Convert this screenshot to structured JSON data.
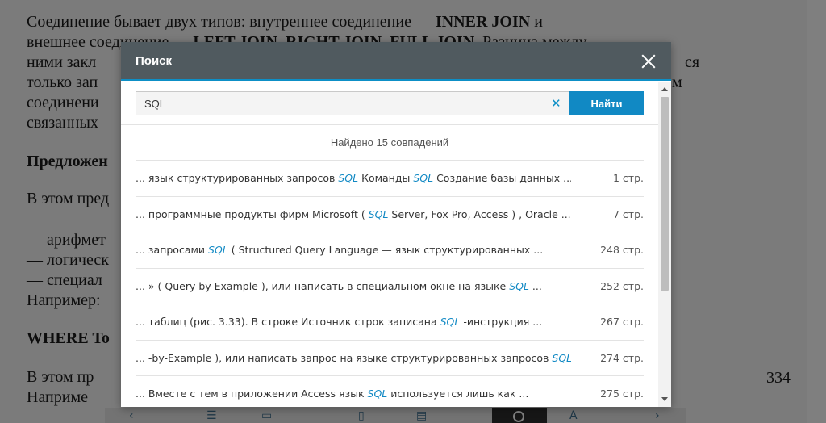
{
  "book": {
    "lines": [
      {
        "pre": "Соединение бывает двух типов: внутреннее соединение — ",
        "bold": "INNER JOIN",
        "post": " и"
      },
      {
        "pre": "внешнее соединение — ",
        "bold": "LEFT JOIN, RIGHT JOIN, FULL JOIN",
        "post": ". Разница между"
      },
      {
        "pre": "ними закл",
        "bold": "",
        "post": "ся"
      },
      {
        "pre": "только зап",
        "bold": "",
        "post": "м"
      },
      {
        "pre": "соединени",
        "bold": "",
        "post": ""
      },
      {
        "pre": "связанных",
        "bold": "",
        "post": ""
      },
      {
        "pre": "",
        "bold": "Предложен",
        "post": ""
      },
      {
        "pre": "В этом пред",
        "bold": "",
        "post": ""
      },
      {
        "pre": "— арифмет",
        "bold": "",
        "post": ""
      },
      {
        "pre": "— логическ",
        "bold": "",
        "post": ""
      },
      {
        "pre": "— специал",
        "bold": "",
        "post": ""
      },
      {
        "pre": "Например:",
        "bold": "",
        "post": ""
      },
      {
        "pre": "",
        "bold": "WHERE To",
        "post": ""
      },
      {
        "pre": "В этом пр",
        "bold": "",
        "post": ""
      },
      {
        "pre": "Наприме",
        "bold": "",
        "post": ""
      }
    ],
    "page_number": "334"
  },
  "dialog": {
    "title": "Поиск",
    "search": {
      "value": "SQL",
      "placeholder": "",
      "clear_glyph": "✕",
      "button_label": "Найти"
    },
    "found_text": "Найдено 15 совпадений",
    "results": [
      {
        "parts": [
          {
            "t": "... язык структурированных запросов ",
            "h": false
          },
          {
            "t": "SQL",
            "h": true
          },
          {
            "t": " Команды ",
            "h": false
          },
          {
            "t": "SQL",
            "h": true
          },
          {
            "t": " Создание базы данных ...",
            "h": false
          }
        ],
        "page": "1 стр."
      },
      {
        "parts": [
          {
            "t": "... программные продукты фирм Microsoft ( ",
            "h": false
          },
          {
            "t": "SQL",
            "h": true
          },
          {
            "t": " Server, Fox Pro, Access ) , Oracle ...",
            "h": false
          }
        ],
        "page": "7 стр."
      },
      {
        "parts": [
          {
            "t": "... запросами ",
            "h": false
          },
          {
            "t": "SQL",
            "h": true
          },
          {
            "t": " ( Structured Query Language  — язык структурированных ...",
            "h": false
          }
        ],
        "page": "248 стр."
      },
      {
        "parts": [
          {
            "t": "... » ( Query by Example ), или написать в специальном окне на языке ",
            "h": false
          },
          {
            "t": "SQL",
            "h": true
          },
          {
            "t": " ...",
            "h": false
          }
        ],
        "page": "252 стр."
      },
      {
        "parts": [
          {
            "t": "... таблиц (рис. 3.33). В строке Источник строк записана ",
            "h": false
          },
          {
            "t": "SQL",
            "h": true
          },
          {
            "t": " -инструкция ...",
            "h": false
          }
        ],
        "page": "267 стр."
      },
      {
        "parts": [
          {
            "t": "... -by-Example ), или написать запрос на языке структурированных запросов ",
            "h": false
          },
          {
            "t": "SQL",
            "h": true
          },
          {
            "t": " ...",
            "h": false
          }
        ],
        "page": "274 стр."
      },
      {
        "parts": [
          {
            "t": "... Вместе с тем в приложении Access язык ",
            "h": false
          },
          {
            "t": "SQL",
            "h": true
          },
          {
            "t": " используется лишь как ...",
            "h": false
          }
        ],
        "page": "275 стр."
      }
    ]
  },
  "colors": {
    "header_bg": "#505a5f",
    "accent": "#1189c4",
    "highlight": "#1189c4"
  }
}
